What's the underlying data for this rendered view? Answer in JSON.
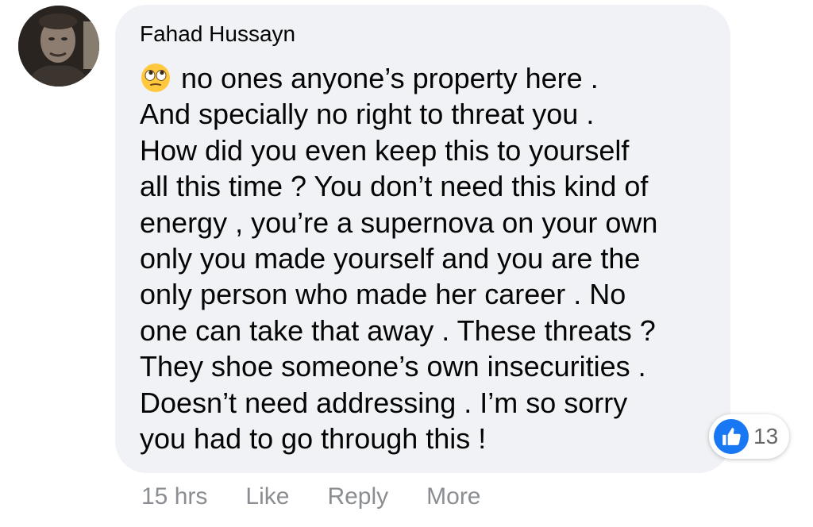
{
  "comment": {
    "author": "Fahad Hussayn",
    "emoji": "face-with-rolling-eyes-icon",
    "lines": [
      "no ones anyone’s property here .",
      "And specially no right to threat you .",
      "How did you even keep this to yourself",
      "all this time ? You don’t need this kind of",
      "energy , you’re a supernova on your own",
      "only you made yourself and you are the",
      "only person who made her career . No",
      "one can take that away . These threats ?",
      "They shoe someone’s own insecurities .",
      "Doesn’t need addressing . I’m so sorry",
      "you had to go through this !"
    ],
    "reactions": {
      "icon": "thumbs-up-icon",
      "count": "13",
      "color": "#1877f2"
    },
    "actions": {
      "time": "15 hrs",
      "like": "Like",
      "reply": "Reply",
      "more": "More"
    }
  },
  "colors": {
    "bubble": "#f0f2f5",
    "text": "#050505",
    "meta": "#8a8d91"
  }
}
